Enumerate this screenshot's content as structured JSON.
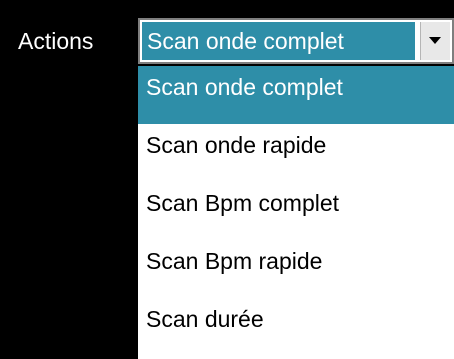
{
  "toolbar": {
    "label": "Actions"
  },
  "select": {
    "value": "Scan onde complet",
    "arrow_icon": "chevron-down-icon"
  },
  "dropdown": {
    "items": [
      {
        "label": "Scan onde complet",
        "selected": true
      },
      {
        "label": "Scan onde rapide",
        "selected": false
      },
      {
        "label": "Scan Bpm complet",
        "selected": false
      },
      {
        "label": "Scan Bpm rapide",
        "selected": false
      },
      {
        "label": "Scan durée",
        "selected": false
      }
    ]
  },
  "colors": {
    "selection": "#2e8ea8",
    "background": "#000000",
    "list_background": "#ffffff",
    "text": "#000000",
    "selected_text": "#ffffff"
  }
}
